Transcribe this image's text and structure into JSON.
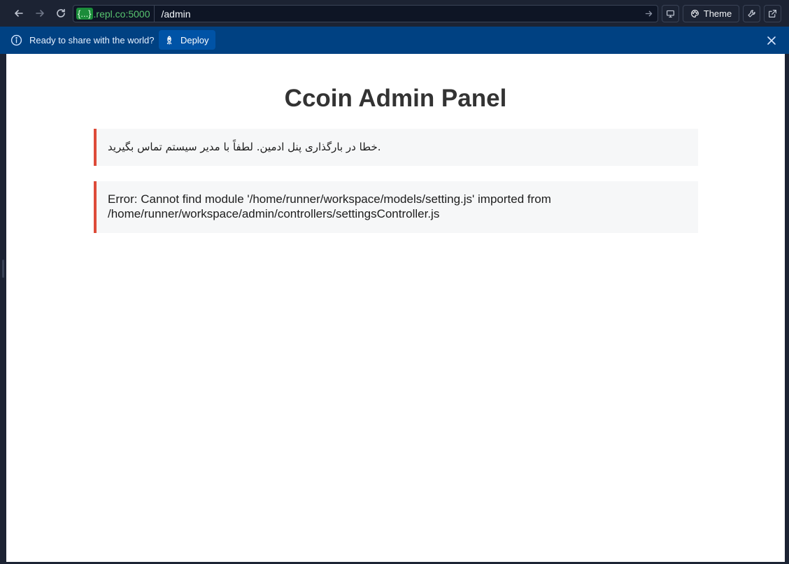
{
  "browser": {
    "url_host_badge": "{...}",
    "url_host_suffix": ".repl.co:5000",
    "url_path": "/admin",
    "theme_label": "Theme"
  },
  "banner": {
    "text": "Ready to share with the world?",
    "deploy_label": "Deploy"
  },
  "page": {
    "title": "Ccoin Admin Panel",
    "persian_error": "خطا در بارگذاری پنل ادمین. لطفاً با مدیر سیستم تماس بگیرید.",
    "error_message": "Error: Cannot find module '/home/runner/workspace/models/setting.js' imported from /home/runner/workspace/admin/controllers/settingsController.js"
  },
  "colors": {
    "banner_bg": "#004182",
    "alert_border": "#dd4b39",
    "url_host": "#58c470"
  }
}
